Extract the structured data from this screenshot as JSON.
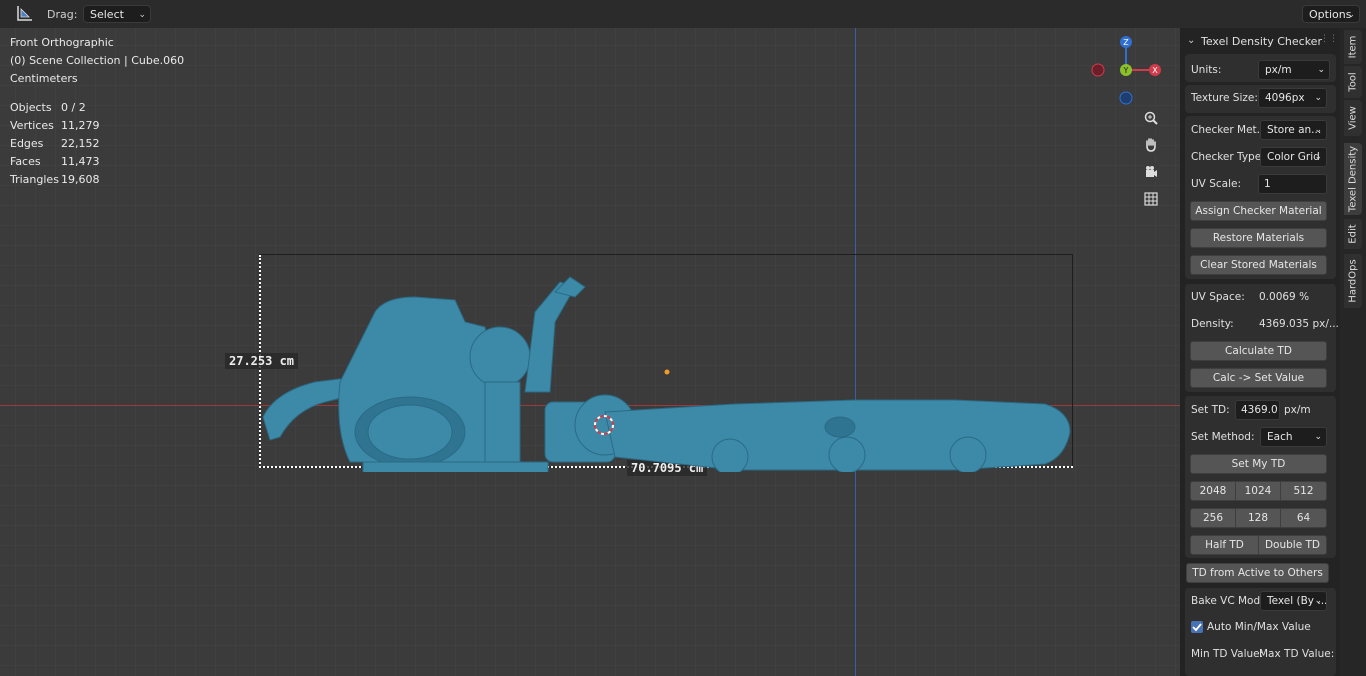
{
  "header": {
    "drag_label": "Drag:",
    "drag_value": "Select Box",
    "options_label": "Options"
  },
  "viewport": {
    "view_name": "Front Orthographic",
    "collection": "(0) Scene Collection | Cube.060",
    "units": "Centimeters",
    "stats": [
      {
        "label": "Objects",
        "value": "0 / 2"
      },
      {
        "label": "Vertices",
        "value": "11,279"
      },
      {
        "label": "Edges",
        "value": "22,152"
      },
      {
        "label": "Faces",
        "value": "11,473"
      },
      {
        "label": "Triangles",
        "value": "19,608"
      }
    ],
    "height_measure": "27.253 cm",
    "width_measure": "70.7095 cm",
    "gizmo": {
      "z": "Z",
      "y": "Y",
      "x": "X"
    },
    "colors": {
      "x_axis": "#d13b4b",
      "y_axis": "#8bc12b",
      "z_axis": "#2f6fd1",
      "model": "#3d8aa8"
    }
  },
  "panel": {
    "title": "Texel Density Checker",
    "units_label": "Units:",
    "units_value": "px/m",
    "texture_size_label": "Texture Size:",
    "texture_size_value": "4096px",
    "checker_method_label": "Checker Met...",
    "checker_method_value": "Store an...",
    "checker_type_label": "Checker Type:",
    "checker_type_value": "Color Grid",
    "uv_scale_label": "UV Scale:",
    "uv_scale_value": "1",
    "assign_checker": "Assign Checker Material",
    "restore_materials": "Restore Materials",
    "clear_stored": "Clear Stored Materials",
    "uv_space_label": "UV Space:",
    "uv_space_value": "0.0069 %",
    "density_label": "Density:",
    "density_value": "4369.035 px/...",
    "calculate_td": "Calculate TD",
    "calc_set_value": "Calc -> Set Value",
    "set_td_label": "Set TD:",
    "set_td_value": "4369.0",
    "set_td_unit": "px/m",
    "set_method_label": "Set Method:",
    "set_method_value": "Each",
    "set_my_td": "Set My TD",
    "presets_row1": [
      "2048",
      "1024",
      "512"
    ],
    "presets_row2": [
      "256",
      "128",
      "64"
    ],
    "half_td": "Half TD",
    "double_td": "Double TD",
    "td_from_active": "TD from Active to Others",
    "bake_vc_label": "Bake VC Mod...",
    "bake_vc_value": "Texel (By ...",
    "auto_minmax": "Auto Min/Max Value",
    "min_td_label": "Min TD Value:",
    "max_td_label": "Max TD Value:"
  },
  "tabs": [
    "Item",
    "Tool",
    "View",
    "Texel Density",
    "Edit",
    "HardOps"
  ]
}
